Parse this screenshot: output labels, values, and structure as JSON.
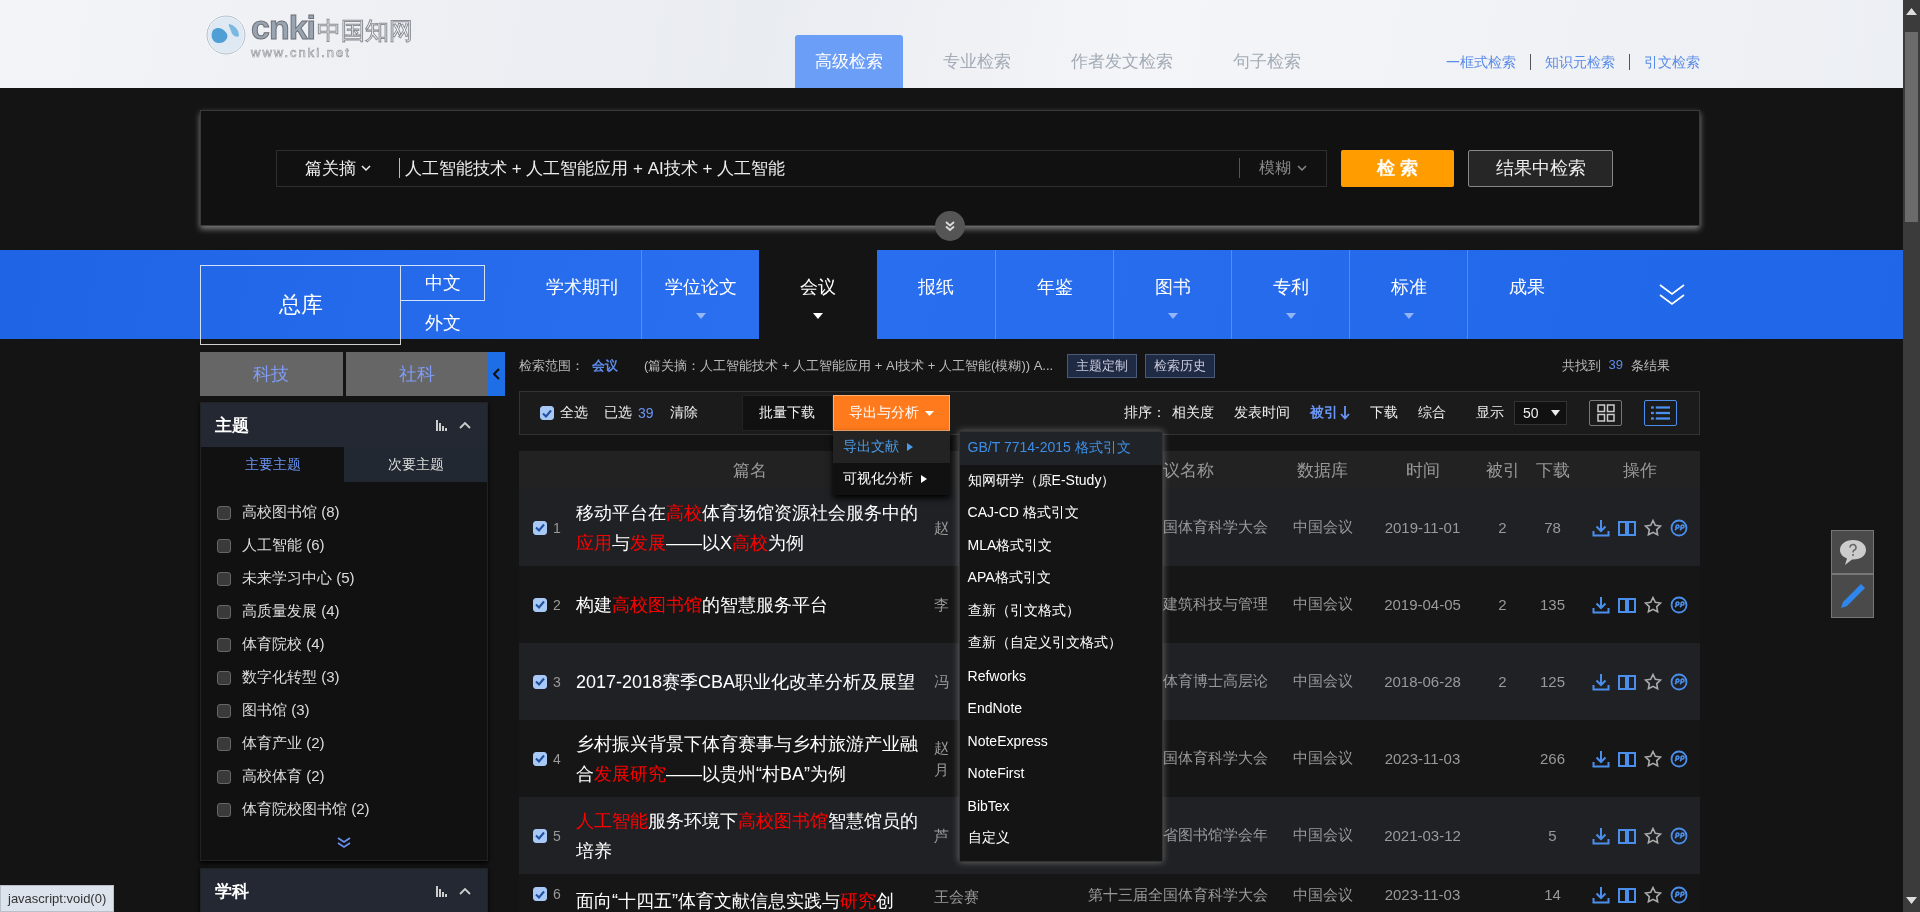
{
  "header": {
    "logo": {
      "name": "cnki",
      "cn_name": "中国知网",
      "url": "www.cnki.net"
    },
    "tabs": [
      {
        "label": "高级检索",
        "selected": true
      },
      {
        "label": "专业检索",
        "selected": false
      },
      {
        "label": "作者发文检索",
        "selected": false
      },
      {
        "label": "句子检索",
        "selected": false
      }
    ],
    "links": [
      "一框式检索",
      "知识元检索",
      "引文检索"
    ]
  },
  "search": {
    "field": "篇关摘",
    "value": "人工智能技术 + 人工智能应用 + AI技术 + 人工智能",
    "match": "模糊",
    "buttons": [
      "检 索",
      "结果中检索"
    ]
  },
  "databases": {
    "main": "总库",
    "languages": [
      "中文",
      "外文"
    ],
    "tabs": [
      {
        "label": "学术期刊",
        "selected": false,
        "expandable": false
      },
      {
        "label": "学位论文",
        "selected": false,
        "expandable": true
      },
      {
        "label": "会议",
        "selected": true,
        "expandable": true
      },
      {
        "label": "报纸",
        "selected": false,
        "expandable": false
      },
      {
        "label": "年鉴",
        "selected": false,
        "expandable": false
      },
      {
        "label": "图书",
        "selected": false,
        "expandable": true
      },
      {
        "label": "专利",
        "selected": false,
        "expandable": true
      },
      {
        "label": "标准",
        "selected": false,
        "expandable": true
      },
      {
        "label": "成果",
        "selected": false,
        "expandable": false
      }
    ]
  },
  "sidebar": {
    "categories": [
      "科技",
      "社科"
    ],
    "facets": [
      {
        "title": "主题",
        "expanded": true,
        "subtabs": [
          {
            "label": "主要主题",
            "selected": true
          },
          {
            "label": "次要主题",
            "selected": false
          }
        ],
        "items": [
          {
            "label": "高校图书馆 (8)",
            "checked": false
          },
          {
            "label": "人工智能 (6)",
            "checked": false
          },
          {
            "label": "未来学习中心 (5)",
            "checked": false
          },
          {
            "label": "高质量发展 (4)",
            "checked": false
          },
          {
            "label": "体育院校 (4)",
            "checked": false
          },
          {
            "label": "数字化转型 (3)",
            "checked": false
          },
          {
            "label": "图书馆 (3)",
            "checked": false
          },
          {
            "label": "体育产业 (2)",
            "checked": false
          },
          {
            "label": "高校体育 (2)",
            "checked": false
          },
          {
            "label": "体育院校图书馆 (2)",
            "checked": false
          }
        ]
      },
      {
        "title": "学科",
        "expanded": true
      }
    ]
  },
  "results": {
    "scope_label": "检索范围：",
    "scope": "会议",
    "query": "(篇关摘：人工智能技术 + 人工智能应用 + AI技术 + 人工智能(模糊)) A...",
    "buttons": [
      "主题定制",
      "检索历史"
    ],
    "found_prefix": "共找到",
    "found_count": "39",
    "found_suffix": "条结果"
  },
  "toolbar": {
    "select_all": {
      "label": "全选",
      "checked": true
    },
    "selected_label": "已选",
    "selected_count": "39",
    "clear": "清除",
    "batch_download": "批量下载",
    "export": {
      "label": "导出与分析",
      "expanded": true,
      "submenu": [
        {
          "label": "导出文献",
          "selected": true
        },
        {
          "label": "可视化分析",
          "selected": false
        }
      ],
      "formats": [
        {
          "label": "GB/T 7714-2015 格式引文",
          "selected": true
        },
        {
          "label": "知网研学（原E-Study）",
          "selected": false
        },
        {
          "label": "CAJ-CD 格式引文",
          "selected": false
        },
        {
          "label": "MLA格式引文",
          "selected": false
        },
        {
          "label": "APA格式引文",
          "selected": false
        },
        {
          "label": "查新（引文格式）",
          "selected": false
        },
        {
          "label": "查新（自定义引文格式）",
          "selected": false
        },
        {
          "label": "Refworks",
          "selected": false
        },
        {
          "label": "EndNote",
          "selected": false
        },
        {
          "label": "NoteExpress",
          "selected": false
        },
        {
          "label": "NoteFirst",
          "selected": false
        },
        {
          "label": "BibTex",
          "selected": false
        },
        {
          "label": "自定义",
          "selected": false
        }
      ]
    },
    "sort_label": "排序：",
    "sort": [
      {
        "label": "相关度",
        "selected": false
      },
      {
        "label": "发表时间",
        "selected": false
      },
      {
        "label": "被引",
        "selected": true
      },
      {
        "label": "下载",
        "selected": false
      },
      {
        "label": "综合",
        "selected": false
      }
    ],
    "display_label": "显示",
    "page_size": "50",
    "views": [
      {
        "kind": "grid",
        "selected": false
      },
      {
        "kind": "list",
        "selected": true
      }
    ]
  },
  "table": {
    "column_headers": [
      "篇名",
      "议名称",
      "数据库",
      "时间",
      "被引",
      "下载",
      "操作"
    ],
    "rows": [
      {
        "number": "1",
        "checked": true,
        "title": "移动平台在**高校**体育场馆资源社会服务中的**应用**与**发展**——以X**高校**为例",
        "authors": [
          "赵"
        ],
        "conference": "国体育科学大会",
        "database": "中国会议",
        "date": "2019-11-01",
        "cited": "2",
        "downloads": "78"
      },
      {
        "number": "2",
        "checked": true,
        "title": "构建**高校图书馆**的智慧服务平台",
        "authors": [
          "李"
        ],
        "conference": "建筑科技与管理",
        "database": "中国会议",
        "date": "2019-04-05",
        "cited": "2",
        "downloads": "135"
      },
      {
        "number": "3",
        "checked": true,
        "title": "2017-2018赛季CBA职业化改革分析及展望",
        "authors": [
          "冯"
        ],
        "conference": "体育博士高层论",
        "database": "中国会议",
        "date": "2018-06-28",
        "cited": "2",
        "downloads": "125"
      },
      {
        "number": "4",
        "checked": true,
        "title": "乡村振兴背景下体育赛事与乡村旅游产业融合**发展研究**——以贵州“村BA”为例",
        "authors": [
          "赵",
          "月"
        ],
        "conference": "国体育科学大会",
        "database": "中国会议",
        "date": "2023-11-03",
        "downloads": "266"
      },
      {
        "number": "5",
        "checked": true,
        "title": "**人工智能**服务环境下**高校图书馆**智慧馆员的培养",
        "authors": [
          "芦"
        ],
        "conference": "省图书馆学会年",
        "database": "中国会议",
        "date": "2021-03-12",
        "downloads": "5"
      },
      {
        "number": "6",
        "checked": true,
        "title": "面向“十四五”体育文献信息实践与**研究**创",
        "authors": [
          "王会赛"
        ],
        "conference": "第十三届全国体育科学大会",
        "database": "中国会议",
        "date": "2023-11-03",
        "downloads": "14"
      }
    ]
  },
  "status_bar": "javascript:void(0)"
}
